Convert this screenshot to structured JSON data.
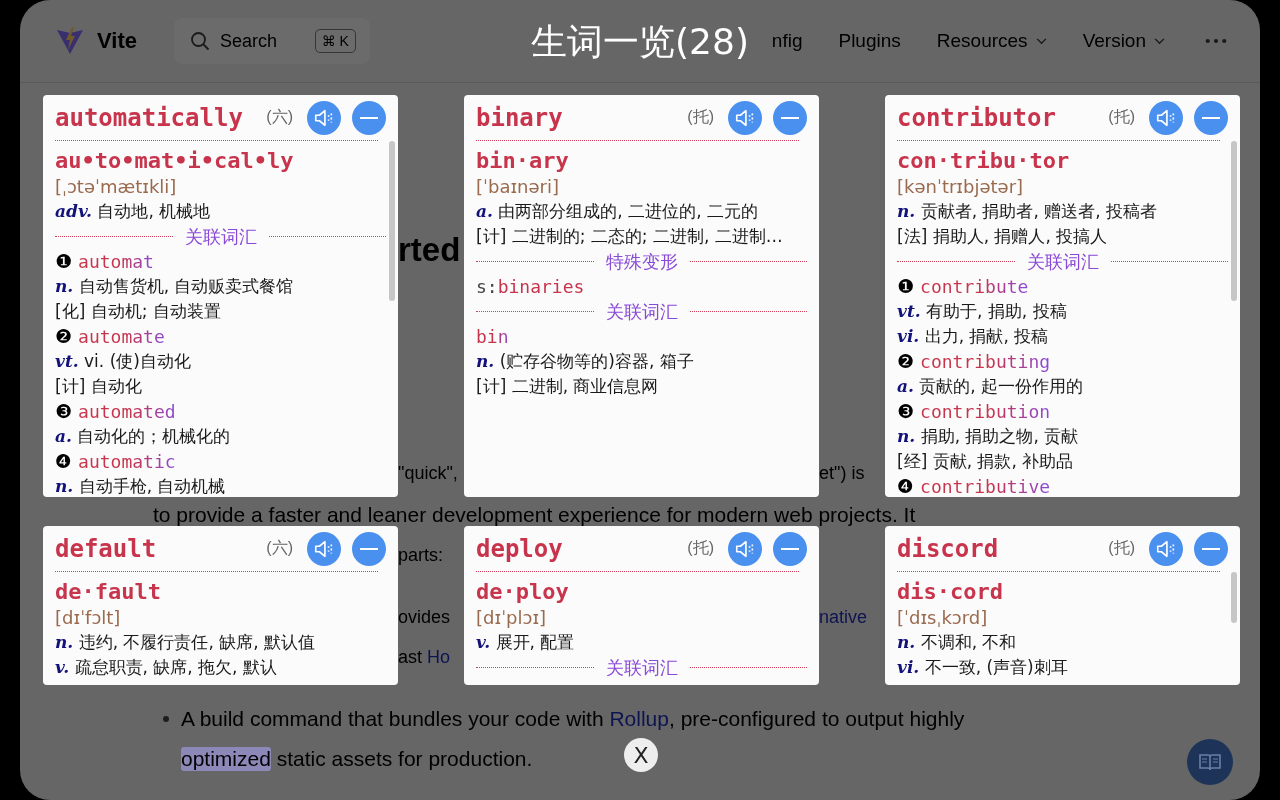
{
  "page": {
    "logo": "Vite",
    "search": {
      "placeholder": "Search",
      "shortcut": "⌘ K"
    },
    "nav": [
      {
        "label": "nfig",
        "dropdown": false
      },
      {
        "label": "Plugins",
        "dropdown": false
      },
      {
        "label": "Resources",
        "dropdown": true
      },
      {
        "label": "Version",
        "dropdown": true
      }
    ],
    "rows": [
      {
        "kind": "gaps",
        "heading": true,
        "left": [
          {
            "text": "rted"
          }
        ],
        "right": []
      },
      {
        "kind": "gaps",
        "heading": false,
        "left": [
          {
            "text": "\"quick\","
          }
        ],
        "right": [
          {
            "text": "et\") is"
          }
        ]
      },
      {
        "kind": "line",
        "pieces": [
          {
            "text": "to provide a faster and leaner development experience for modern web projects. It"
          }
        ]
      },
      {
        "kind": "gaps",
        "heading": false,
        "left": [
          {
            "text": "parts:"
          }
        ],
        "right": []
      },
      {
        "kind": "gaps",
        "heading": false,
        "left": [
          {
            "text": "ovides"
          }
        ],
        "right": [
          {
            "text": "native",
            "link": true
          }
        ]
      },
      {
        "kind": "gaps",
        "heading": false,
        "left": [
          {
            "text": "ast "
          },
          {
            "text": "Ho",
            "link": true
          }
        ],
        "right": []
      },
      {
        "kind": "bullet",
        "pieces": [
          {
            "text": "A build command that bundles your code with "
          },
          {
            "text": "Rollup",
            "link": true
          },
          {
            "text": ", pre-configured to output highly"
          }
        ]
      },
      {
        "kind": "continuation",
        "pieces": [
          {
            "text": "optimized",
            "highlight": true
          },
          {
            "text": " static assets for production."
          }
        ]
      }
    ]
  },
  "overlay": {
    "title": "生词一览(28)",
    "close": "X",
    "cards": [
      {
        "word": "automatically",
        "tag": "(六)",
        "scrollbar": true,
        "lines": [
          {
            "kind": "syllables",
            "text": "au•to•mat•i•cal•ly"
          },
          {
            "kind": "phonetic",
            "text": "[ˌɔtəˈmætɪkli]"
          },
          {
            "kind": "def",
            "pos": "adv.",
            "text": "自动地, 机械地"
          },
          {
            "kind": "section",
            "text": "关联词汇"
          },
          {
            "kind": "related",
            "number": "❶",
            "text": "automat"
          },
          {
            "kind": "def",
            "pos": "n.",
            "text": "自动售货机, 自动贩卖式餐馆"
          },
          {
            "kind": "def",
            "text": "[化] 自动机; 自动装置"
          },
          {
            "kind": "related",
            "number": "❷",
            "text": "automate"
          },
          {
            "kind": "def",
            "pos": "vt.",
            "text": "vi. (使)自动化"
          },
          {
            "kind": "def",
            "text": "[计] 自动化"
          },
          {
            "kind": "related",
            "number": "❸",
            "text": "automated"
          },
          {
            "kind": "def",
            "pos": "a.",
            "text": "自动化的；机械化的"
          },
          {
            "kind": "related",
            "number": "❹",
            "text": "automatic"
          },
          {
            "kind": "def",
            "pos": "n.",
            "text": "自动手枪, 自动机械"
          }
        ]
      },
      {
        "word": "binary",
        "tag": "(托)",
        "scrollbar": false,
        "lines": [
          {
            "kind": "syllables",
            "text": "bin·ary"
          },
          {
            "kind": "phonetic",
            "text": "[ˈbaɪnəri]"
          },
          {
            "kind": "def",
            "pos": "a.",
            "text": "由两部分组成的, 二进位的, 二元的"
          },
          {
            "kind": "def",
            "text": "[计] 二进制的; 二态的; 二进制, 二进制…"
          },
          {
            "kind": "section",
            "text": "特殊变形"
          },
          {
            "kind": "form",
            "prefix": "s:",
            "text": "binaries"
          },
          {
            "kind": "section",
            "text": "关联词汇"
          },
          {
            "kind": "related",
            "text": "bin"
          },
          {
            "kind": "def",
            "pos": "n.",
            "text": "(贮存谷物等的)容器, 箱子"
          },
          {
            "kind": "def",
            "text": "[计] 二进制, 商业信息网"
          }
        ]
      },
      {
        "word": "contributor",
        "tag": "(托)",
        "scrollbar": true,
        "lines": [
          {
            "kind": "syllables",
            "text": "con·tribu·tor"
          },
          {
            "kind": "phonetic",
            "text": "[kənˈtrɪbjətər]"
          },
          {
            "kind": "def",
            "pos": "n.",
            "text": "贡献者, 捐助者, 赠送者, 投稿者"
          },
          {
            "kind": "def",
            "text": "[法] 捐助人, 捐赠人, 投搞人"
          },
          {
            "kind": "section",
            "text": "关联词汇"
          },
          {
            "kind": "related",
            "number": "❶",
            "text": "contribute"
          },
          {
            "kind": "def",
            "pos": "vt.",
            "text": "有助于, 捐助, 投稿"
          },
          {
            "kind": "def",
            "pos": "vi.",
            "text": "出力, 捐献, 投稿"
          },
          {
            "kind": "related",
            "number": "❷",
            "text": "contributing"
          },
          {
            "kind": "def",
            "pos": "a.",
            "text": "贡献的, 起一份作用的"
          },
          {
            "kind": "related",
            "number": "❸",
            "text": "contribution"
          },
          {
            "kind": "def",
            "pos": "n.",
            "text": "捐助, 捐助之物, 贡献"
          },
          {
            "kind": "def",
            "text": "[经] 贡献, 捐款, 补助品"
          },
          {
            "kind": "related",
            "number": "❹",
            "text": "contributive"
          }
        ]
      },
      {
        "word": "default",
        "tag": "(六)",
        "scrollbar": false,
        "lines": [
          {
            "kind": "syllables",
            "text": "de·fault"
          },
          {
            "kind": "phonetic",
            "text": "[dɪˈfɔlt]"
          },
          {
            "kind": "def",
            "pos": "n.",
            "text": "违约, 不履行责任, 缺席, 默认值"
          },
          {
            "kind": "def",
            "pos": "v.",
            "text": "疏怠职责, 缺席, 拖欠, 默认"
          }
        ]
      },
      {
        "word": "deploy",
        "tag": "(托)",
        "scrollbar": false,
        "lines": [
          {
            "kind": "syllables",
            "text": "de·ploy"
          },
          {
            "kind": "phonetic",
            "text": "[dɪˈplɔɪ]"
          },
          {
            "kind": "def",
            "pos": "v.",
            "text": "展开, 配置"
          },
          {
            "kind": "section",
            "text": "关联词汇"
          }
        ]
      },
      {
        "word": "discord",
        "tag": "(托)",
        "scrollbar": true,
        "lines": [
          {
            "kind": "syllables",
            "text": "dis·cord"
          },
          {
            "kind": "phonetic",
            "text": "[ˈdɪsˌkɔrd]"
          },
          {
            "kind": "def",
            "pos": "n.",
            "text": "不调和, 不和"
          },
          {
            "kind": "def",
            "pos": "vi.",
            "text": "不一致, (声音)刺耳"
          }
        ]
      }
    ]
  }
}
